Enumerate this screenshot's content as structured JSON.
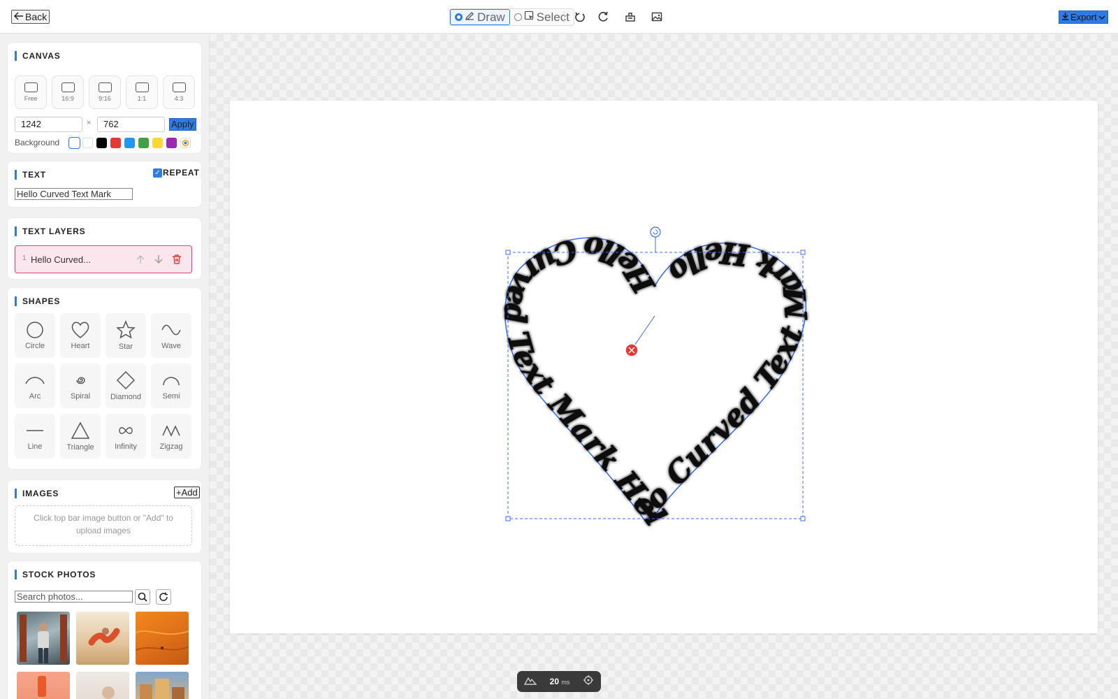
{
  "topbar": {
    "back_label": "Back",
    "mode_draw_label": "Draw",
    "mode_select_label": "Select",
    "active_mode": "Draw",
    "icons": [
      "undo-icon",
      "redo-icon",
      "clear-icon",
      "image-icon"
    ],
    "export_label": "Export",
    "accent_color": "#2d7be6"
  },
  "canvas_panel": {
    "title": "CANVAS",
    "ratios": [
      "Free",
      "16:9",
      "9:16",
      "1:1",
      "4:3"
    ],
    "width_value": "1242",
    "height_value": "762",
    "times_symbol": "×",
    "apply_label": "Apply",
    "background_label": "Background",
    "swatches": [
      "#ffffff",
      "#ffffff",
      "#000000",
      "#e53935",
      "#2196f3",
      "#43a047",
      "#fdd835",
      "#9c27b0"
    ]
  },
  "text_panel": {
    "title": "TEXT",
    "repeat_label": "REPEAT",
    "repeat_checked": true,
    "text_value": "Hello Curved Text Mark"
  },
  "layers_panel": {
    "title": "TEXT LAYERS",
    "layers": [
      {
        "index": "1",
        "name": "Hello Curved..."
      }
    ]
  },
  "shapes_panel": {
    "title": "SHAPES",
    "shapes": [
      "Circle",
      "Heart",
      "Star",
      "Wave",
      "Arc",
      "Spiral",
      "Diamond",
      "Semi",
      "Line",
      "Triangle",
      "Infinity",
      "Zigzag"
    ]
  },
  "images_panel": {
    "title": "IMAGES",
    "add_label": "Add",
    "dropzone_text": "Click top bar image button or \"Add\" to upload images"
  },
  "stock_panel": {
    "title": "STOCK PHOTOS",
    "search_placeholder": "Search photos..."
  },
  "canvas": {
    "curved_text": "Hello Curved Text Mark Hello Curved Text Mark Hello Curved Text Mark Hello Curved Text Mark ",
    "path_shape": "heart"
  },
  "status": {
    "render_time": "20",
    "render_unit": "ms"
  }
}
